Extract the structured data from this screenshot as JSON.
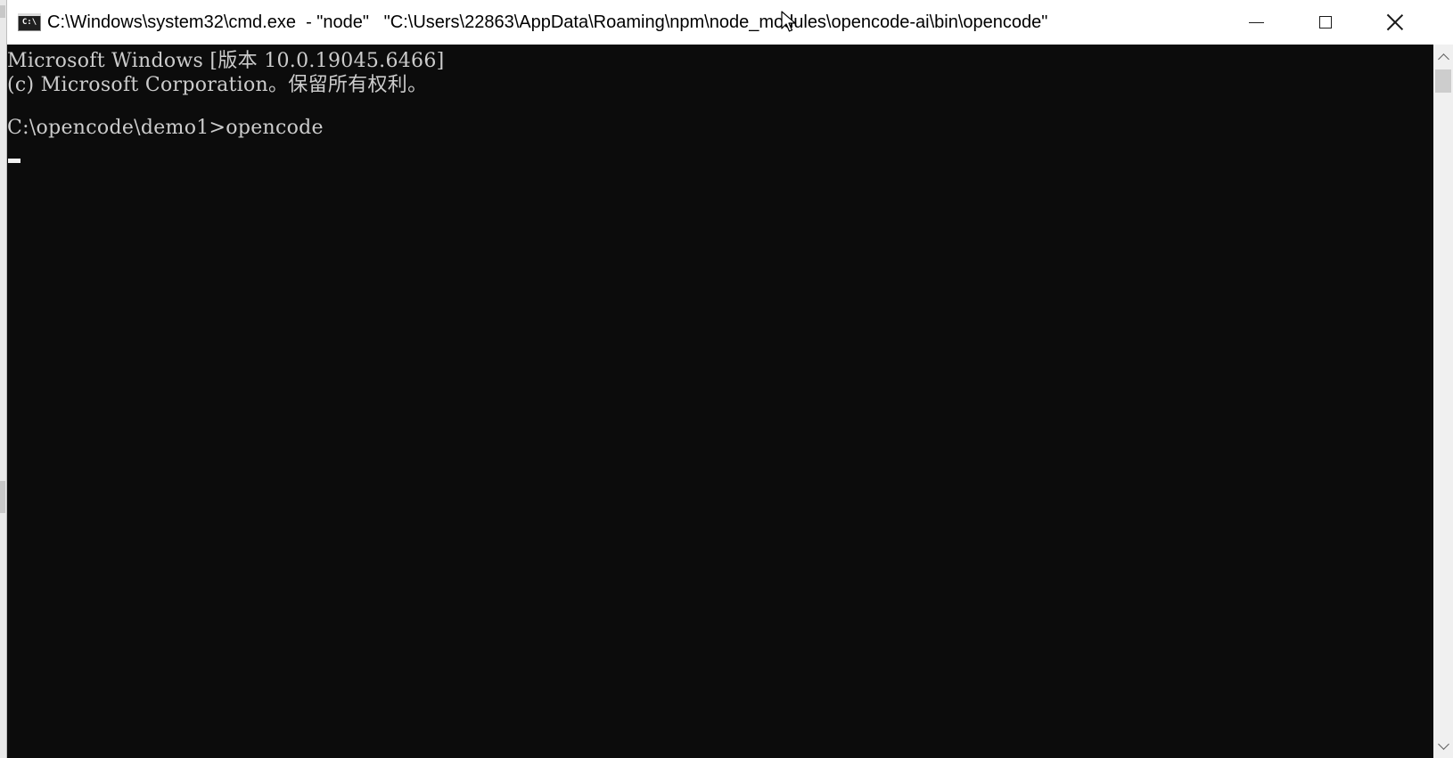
{
  "window": {
    "title": "C:\\Windows\\system32\\cmd.exe  - \"node\"   \"C:\\Users\\22863\\AppData\\Roaming\\npm\\node_modules\\opencode-ai\\bin\\opencode\"",
    "icon": "console-icon",
    "icon_text": "C:\\",
    "controls": {
      "minimize": "minimize-icon",
      "maximize": "maximize-icon",
      "close": "close-icon"
    }
  },
  "console": {
    "background": "#0c0c0c",
    "foreground": "#cccccc",
    "lines": [
      "Microsoft Windows [版本 10.0.19045.6466]",
      "(c) Microsoft Corporation。保留所有权利。",
      "",
      "C:\\opencode\\demo1>opencode"
    ]
  },
  "scrollbar": {
    "up": "chevron-up-icon",
    "down": "chevron-down-icon"
  }
}
